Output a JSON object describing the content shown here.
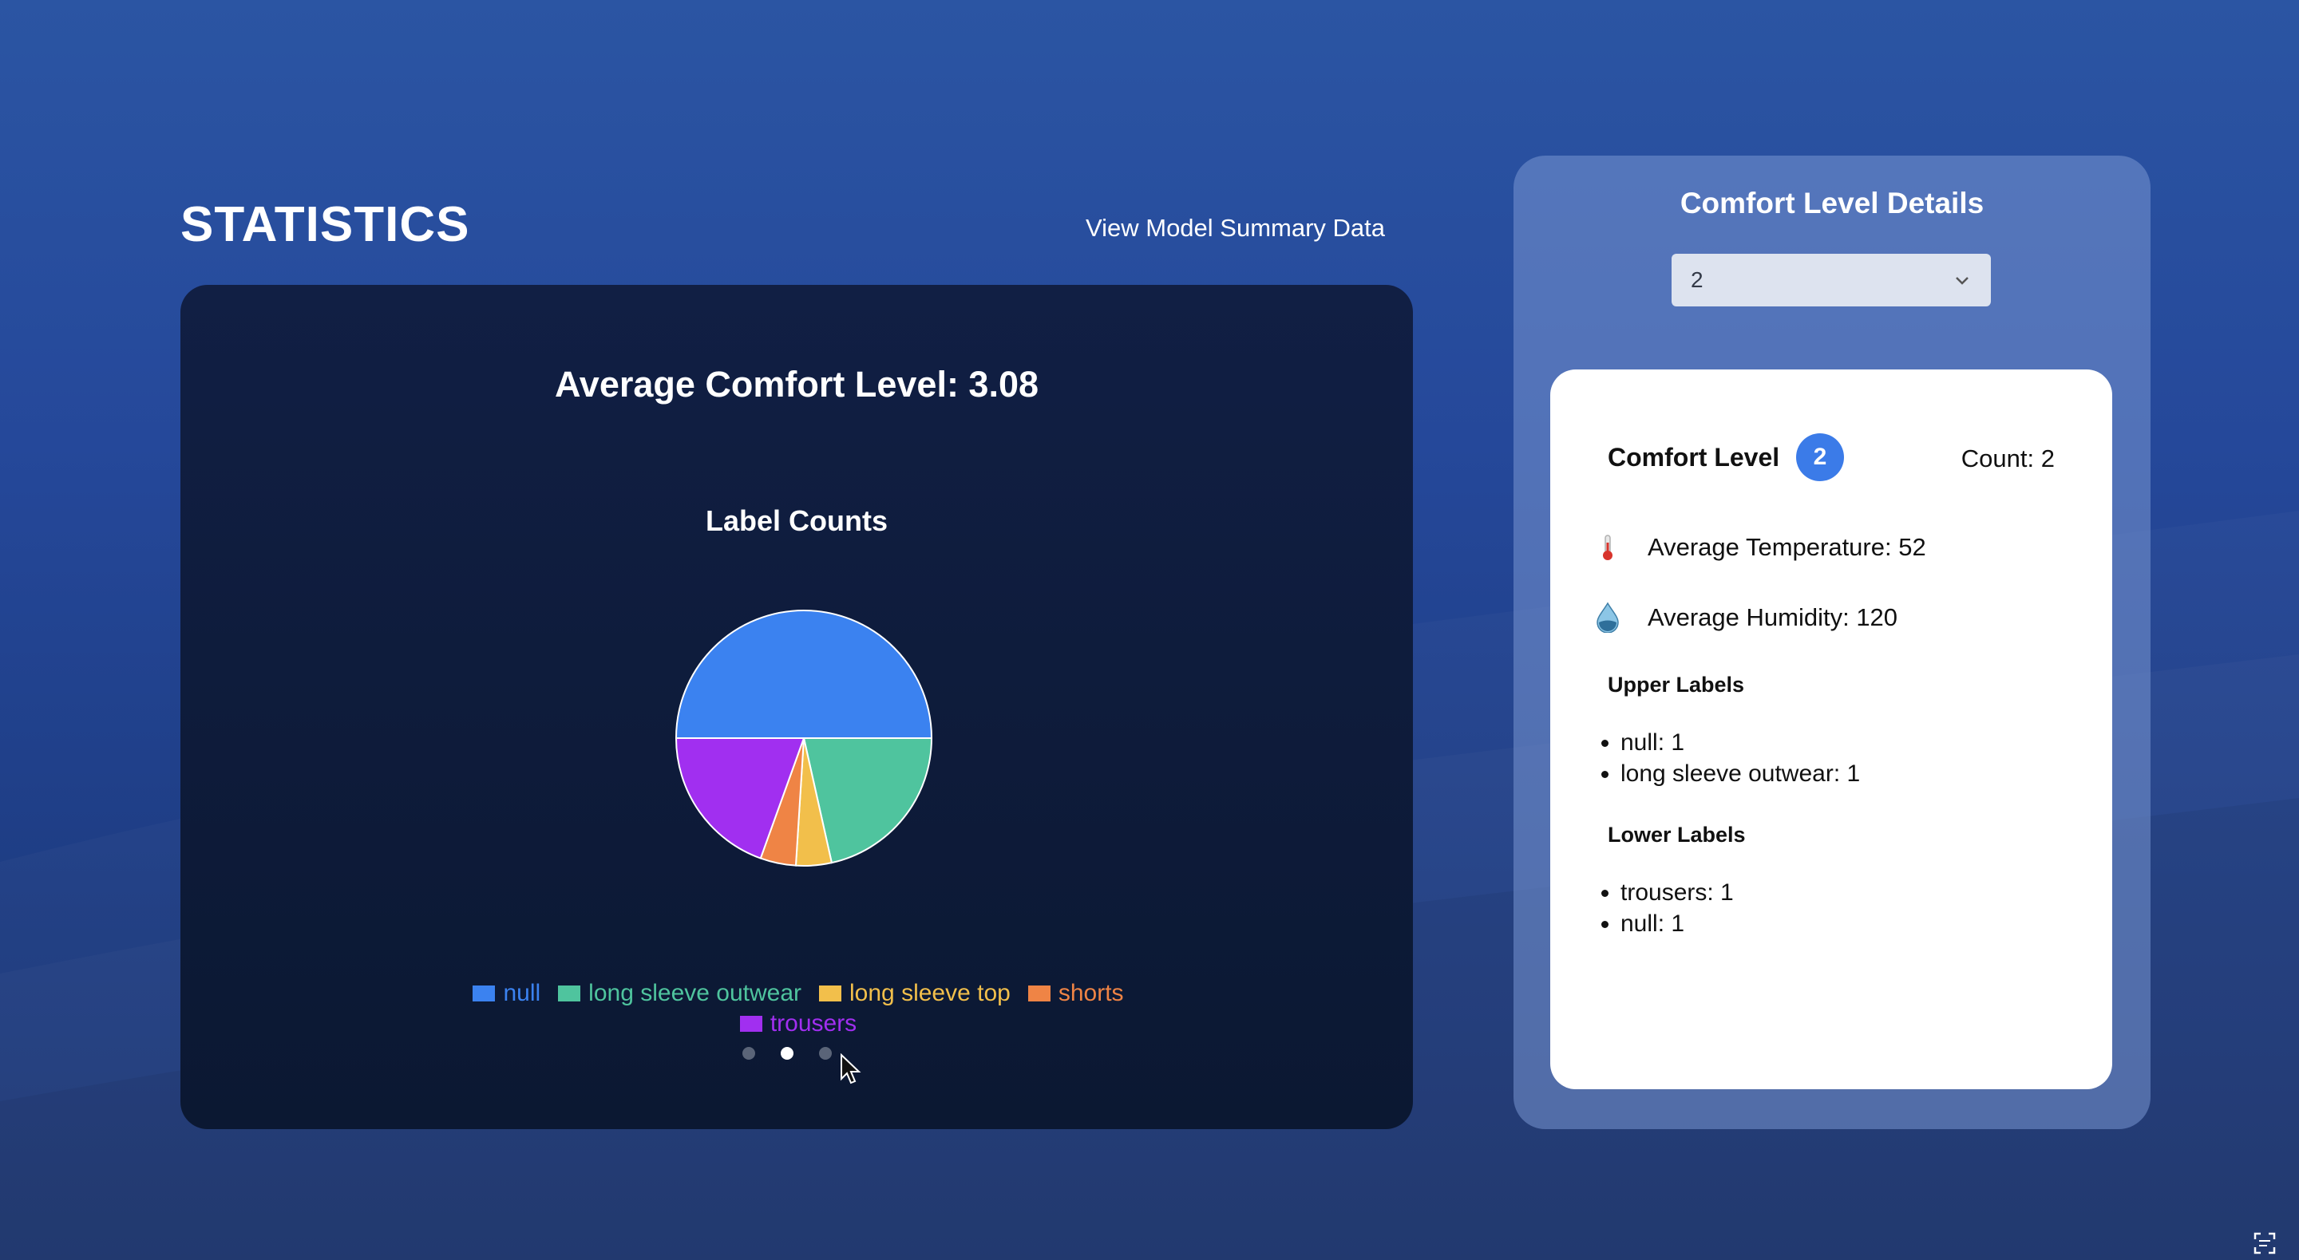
{
  "page": {
    "title": "STATISTICS",
    "summary_link": "View Model Summary Data"
  },
  "stats": {
    "average_title": "Average Comfort Level: 3.08",
    "chart_title": "Label Counts"
  },
  "chart_data": {
    "type": "pie",
    "title": "Label Counts",
    "categories": [
      "null",
      "long sleeve outwear",
      "long sleeve top",
      "shorts",
      "trousers"
    ],
    "values": [
      50,
      21.5,
      4.5,
      4.5,
      19.5
    ],
    "colors": [
      "#3b82f0",
      "#4fc49e",
      "#f2bf4b",
      "#ef8445",
      "#a12ff0"
    ],
    "legend_position": "bottom",
    "slide_dots": 3,
    "active_slide": 2
  },
  "legend": {
    "items": [
      {
        "label": "null",
        "color": "#3b82f0"
      },
      {
        "label": "long sleeve outwear",
        "color": "#4fc49e"
      },
      {
        "label": "long sleeve top",
        "color": "#f2bf4b"
      },
      {
        "label": "shorts",
        "color": "#ef8445"
      },
      {
        "label": "trousers",
        "color": "#a12ff0"
      }
    ]
  },
  "details": {
    "title": "Comfort Level Details",
    "selected_level": "2",
    "card": {
      "comfort_label": "Comfort Level",
      "level_badge": "2",
      "count": "Count: 2",
      "avg_temperature": "Average Temperature: 52",
      "avg_humidity": "Average Humidity: 120",
      "temperature_icon": "thermometer-icon",
      "humidity_icon": "water-drop-icon",
      "upper_heading": "Upper Labels",
      "upper_labels": [
        "null: 1",
        "long sleeve outwear: 1"
      ],
      "lower_heading": "Lower Labels",
      "lower_labels": [
        "trousers: 1",
        "null: 1"
      ]
    }
  },
  "colors": {
    "background": "#2b55a3",
    "card_dark": "#0f1c3d",
    "accent_blue": "#3b7be8",
    "panel": "#6f8dcf"
  }
}
